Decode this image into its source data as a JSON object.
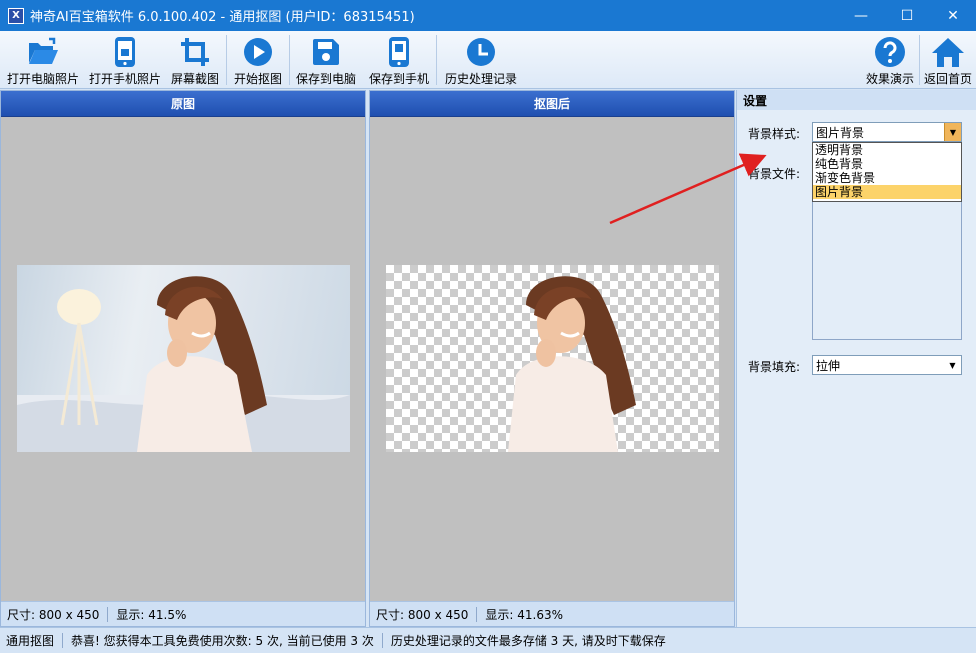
{
  "window": {
    "icon_text": "X",
    "title": "神奇AI百宝箱软件 6.0.100.402 - 通用抠图 (用户ID：68315451)",
    "minimize_glyph": "—",
    "maximize_glyph": "☐",
    "close_glyph": "✕"
  },
  "toolbar": {
    "items": [
      {
        "label": "打开电脑照片",
        "icon": "folder-open-icon"
      },
      {
        "label": "打开手机照片",
        "icon": "phone-icon"
      },
      {
        "label": "屏幕截图",
        "icon": "crop-icon"
      },
      {
        "label": "开始抠图",
        "icon": "play-icon"
      },
      {
        "label": "保存到电脑",
        "icon": "save-disk-icon"
      },
      {
        "label": "保存到手机",
        "icon": "phone-save-icon"
      },
      {
        "label": "历史处理记录",
        "icon": "clock-icon"
      }
    ],
    "right_items": [
      {
        "label": "效果演示",
        "icon": "help-icon"
      },
      {
        "label": "返回首页",
        "icon": "home-icon"
      }
    ],
    "accent_color": "#1a78d2"
  },
  "left_panel": {
    "title": "原图",
    "size_text": "尺寸: 800 x 450",
    "display_text": "显示: 41.5%"
  },
  "right_panel": {
    "title": "抠图后",
    "size_text": "尺寸: 800 x 450",
    "display_text": "显示: 41.63%"
  },
  "settings": {
    "header": "设置",
    "bg_style_label": "背景样式:",
    "bg_style_value": "图片背景",
    "bg_style_options": [
      "透明背景",
      "纯色背景",
      "渐变色背景",
      "图片背景"
    ],
    "bg_style_selected_index": 3,
    "bg_file_label": "背景文件:",
    "bg_fill_label": "背景填充:",
    "bg_fill_value": "拉伸"
  },
  "statusbar": {
    "mode": "通用抠图",
    "usage": "恭喜! 您获得本工具免费使用次数: 5 次, 当前已使用 3 次",
    "history_note": "历史处理记录的文件最多存储 3 天, 请及时下载保存"
  }
}
